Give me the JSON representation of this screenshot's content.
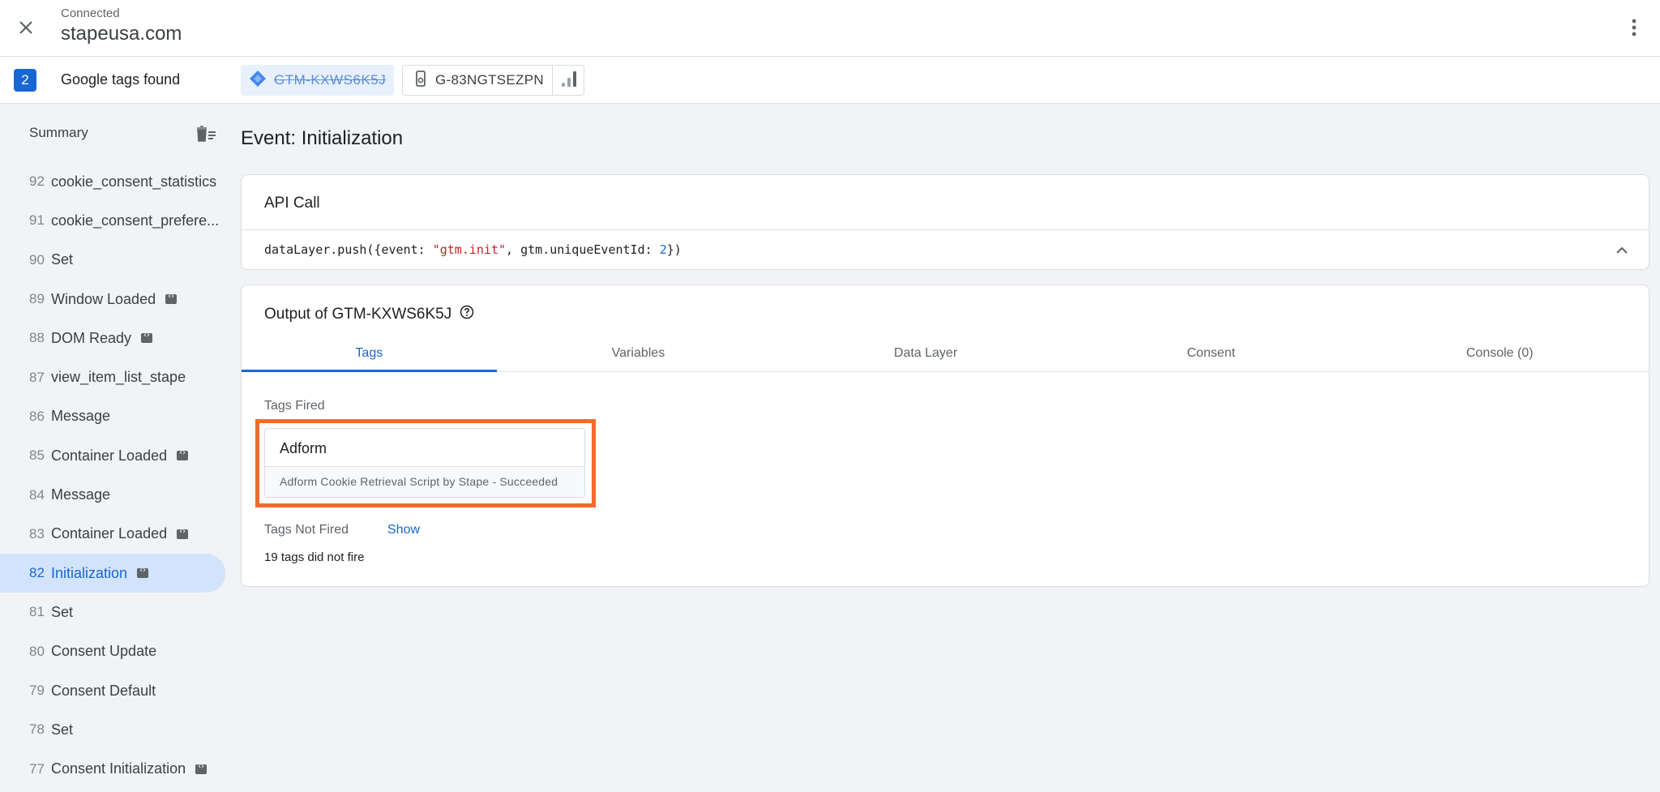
{
  "header": {
    "status": "Connected",
    "domain": "stapeusa.com"
  },
  "tags_bar": {
    "count": "2",
    "label": "Google tags found",
    "gtm_chip": "GTM-KXWS6K5J",
    "ga_chip": "G-83NGTSEZPN"
  },
  "sidebar": {
    "summary_label": "Summary",
    "events": [
      {
        "num": "92",
        "name": "cookie_consent_statistics",
        "has_code_icon": false
      },
      {
        "num": "91",
        "name": "cookie_consent_prefere...",
        "has_code_icon": false
      },
      {
        "num": "90",
        "name": "Set",
        "has_code_icon": false
      },
      {
        "num": "89",
        "name": "Window Loaded",
        "has_code_icon": true
      },
      {
        "num": "88",
        "name": "DOM Ready",
        "has_code_icon": true
      },
      {
        "num": "87",
        "name": "view_item_list_stape",
        "has_code_icon": false
      },
      {
        "num": "86",
        "name": "Message",
        "has_code_icon": false
      },
      {
        "num": "85",
        "name": "Container Loaded",
        "has_code_icon": true
      },
      {
        "num": "84",
        "name": "Message",
        "has_code_icon": false
      },
      {
        "num": "83",
        "name": "Container Loaded",
        "has_code_icon": true
      },
      {
        "num": "82",
        "name": "Initialization",
        "has_code_icon": true,
        "active": true
      },
      {
        "num": "81",
        "name": "Set",
        "has_code_icon": false
      },
      {
        "num": "80",
        "name": "Consent Update",
        "has_code_icon": false
      },
      {
        "num": "79",
        "name": "Consent Default",
        "has_code_icon": false
      },
      {
        "num": "78",
        "name": "Set",
        "has_code_icon": false
      },
      {
        "num": "77",
        "name": "Consent Initialization",
        "has_code_icon": true
      }
    ]
  },
  "main": {
    "title": "Event: Initialization",
    "api_card": {
      "title": "API Call",
      "code_prefix": "dataLayer.push({event: ",
      "code_string": "\"gtm.init\"",
      "code_middle": ", gtm.uniqueEventId: ",
      "code_number": "2",
      "code_suffix": "})"
    },
    "output_card": {
      "title": "Output of GTM-KXWS6K5J",
      "tabs": [
        "Tags",
        "Variables",
        "Data Layer",
        "Consent",
        "Console (0)"
      ],
      "tags_fired_label": "Tags Fired",
      "fired_tag": {
        "name": "Adform",
        "detail": "Adform Cookie Retrieval Script by Stape - Succeeded"
      },
      "not_fired_label": "Tags Not Fired",
      "show_link": "Show",
      "not_fired_count": "19 tags did not fire"
    }
  },
  "colors": {
    "accent": "#1967d2",
    "highlight": "#f26a2e",
    "active_bg": "#d2e3fc"
  }
}
